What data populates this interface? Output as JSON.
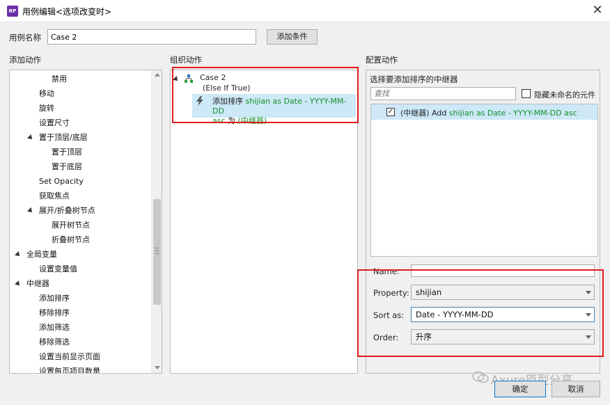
{
  "window": {
    "title": "用例编辑<选项改变时>",
    "app_icon_text": "RP",
    "close_glyph": "✕"
  },
  "case_name": {
    "label": "用例名称",
    "value": "Case 2",
    "add_condition_label": "添加条件"
  },
  "sections": {
    "add_actions": "添加动作",
    "organize_actions": "组织动作",
    "configure_actions": "配置动作"
  },
  "add_actions_list": [
    {
      "label": "禁用",
      "level": 2,
      "expandable": false
    },
    {
      "label": "移动",
      "level": 1,
      "expandable": false
    },
    {
      "label": "旋转",
      "level": 1,
      "expandable": false
    },
    {
      "label": "设置尺寸",
      "level": 1,
      "expandable": false
    },
    {
      "label": "置于顶层/底层",
      "level": 1,
      "expandable": true
    },
    {
      "label": "置于顶层",
      "level": 2,
      "expandable": false
    },
    {
      "label": "置于底层",
      "level": 2,
      "expandable": false
    },
    {
      "label": "Set Opacity",
      "level": 1,
      "expandable": false
    },
    {
      "label": "获取焦点",
      "level": 1,
      "expandable": false
    },
    {
      "label": "展开/折叠树节点",
      "level": 1,
      "expandable": true
    },
    {
      "label": "展开树节点",
      "level": 2,
      "expandable": false
    },
    {
      "label": "折叠树节点",
      "level": 2,
      "expandable": false
    },
    {
      "label": "全局变量",
      "level": 0,
      "expandable": true
    },
    {
      "label": "设置变量值",
      "level": 1,
      "expandable": false
    },
    {
      "label": "中继器",
      "level": 0,
      "expandable": true
    },
    {
      "label": "添加排序",
      "level": 1,
      "expandable": false
    },
    {
      "label": "移除排序",
      "level": 1,
      "expandable": false
    },
    {
      "label": "添加筛选",
      "level": 1,
      "expandable": false
    },
    {
      "label": "移除筛选",
      "level": 1,
      "expandable": false
    },
    {
      "label": "设置当前显示页面",
      "level": 1,
      "expandable": false
    },
    {
      "label": "设置每页项目数量",
      "level": 1,
      "expandable": false
    }
  ],
  "organize": {
    "case_label": "Case 2",
    "case_condition": "(Else If True)",
    "action_prefix": "添加排序 ",
    "action_green_1": "shijian as Date - YYYY-MM-DD",
    "action_line2_green": "asc",
    "action_line2_mid": " 为 ",
    "action_line2_target": "(中继器)"
  },
  "configure": {
    "pick_label": "选择要添加排序的中继器",
    "search_placeholder": "查找",
    "hide_unnamed_label": "隐藏未命名的元件",
    "repeater_row_prefix": "(中继器) Add ",
    "repeater_row_green": "shijian as Date - YYYY-MM-DD asc",
    "repeater_checked_glyph": "✓",
    "name_label": "Name:",
    "name_value": "",
    "property_label": "Property:",
    "property_value": "shijian",
    "sort_as_label": "Sort as:",
    "sort_as_value": "Date - YYYY-MM-DD",
    "order_label": "Order:",
    "order_value": "升序"
  },
  "buttons": {
    "ok": "确定",
    "cancel": "取消"
  },
  "watermark": {
    "text": "Axure原型分享"
  },
  "colors": {
    "highlight_red": "#e11b1b",
    "selection_blue": "#cde8f7",
    "green_text": "#15902a",
    "app_icon_purple": "#6d2fa8"
  }
}
